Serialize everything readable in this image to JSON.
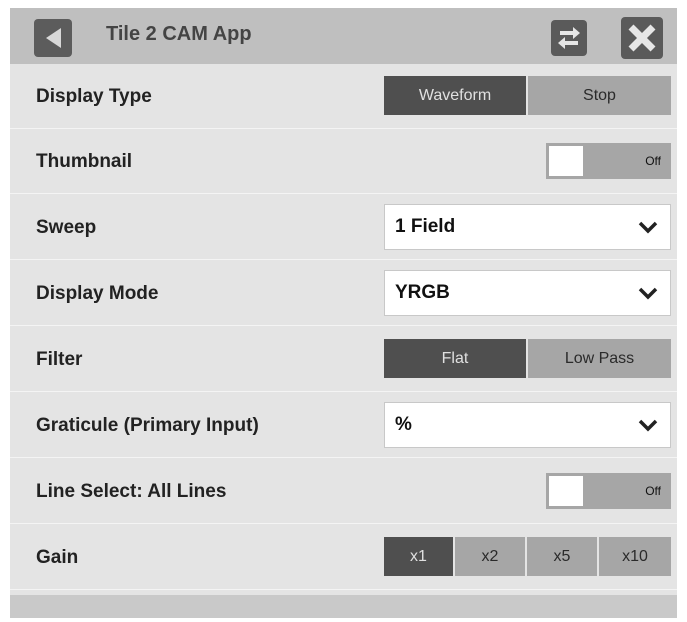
{
  "header": {
    "title": "Tile 2 CAM App",
    "back_icon": "back-arrow-icon",
    "swap_icon": "swap-arrows-icon",
    "close_icon": "close-x-icon"
  },
  "rows": {
    "display_type": {
      "label": "Display Type",
      "options": [
        "Waveform",
        "Stop"
      ],
      "selected": "Waveform"
    },
    "thumbnail": {
      "label": "Thumbnail",
      "state": "Off"
    },
    "sweep": {
      "label": "Sweep",
      "value": "1 Field"
    },
    "display_mode": {
      "label": "Display Mode",
      "value": "YRGB"
    },
    "filter": {
      "label": "Filter",
      "options": [
        "Flat",
        "Low Pass"
      ],
      "selected": "Flat"
    },
    "graticule": {
      "label": "Graticule (Primary Input)",
      "value": "%"
    },
    "line_select": {
      "label": "Line Select: All Lines",
      "state": "Off"
    },
    "gain": {
      "label": "Gain",
      "options": [
        "x1",
        "x2",
        "x5",
        "x10"
      ],
      "selected": "x1"
    }
  },
  "colors": {
    "active": "#4f4f4f",
    "inactive": "#a6a6a6",
    "header": "#bfbfbf",
    "panel": "#e4e4e4"
  }
}
